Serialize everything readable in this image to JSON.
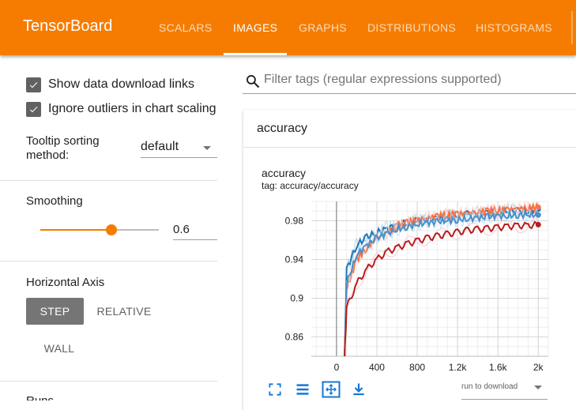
{
  "app": {
    "title": "TensorBoard",
    "accent_color": "#f57c00",
    "tabs": [
      {
        "label": "SCALARS",
        "active": false
      },
      {
        "label": "IMAGES",
        "active": true
      },
      {
        "label": "GRAPHS",
        "active": false
      },
      {
        "label": "DISTRIBUTIONS",
        "active": false
      },
      {
        "label": "HISTOGRAMS",
        "active": false
      }
    ]
  },
  "sidebar": {
    "checkboxes": [
      {
        "label": "Show data download links",
        "checked": true
      },
      {
        "label": "Ignore outliers in chart scaling",
        "checked": true
      }
    ],
    "tooltip_sorting": {
      "label": "Tooltip sorting method:",
      "value": "default"
    },
    "smoothing": {
      "label": "Smoothing",
      "value": "0.6",
      "fraction": 0.6
    },
    "horizontal_axis": {
      "label": "Horizontal Axis",
      "options": [
        "STEP",
        "RELATIVE",
        "WALL"
      ],
      "selected": "STEP"
    },
    "runs_label": "Runs"
  },
  "main": {
    "search_placeholder": "Filter tags (regular expressions supported)",
    "card_title": "accuracy",
    "chart": {
      "title": "accuracy",
      "tag": "tag: accuracy/accuracy"
    },
    "icons": [
      "fullscreen-icon",
      "list-icon",
      "fit-domain-icon",
      "download-icon"
    ],
    "run_download": "run to download"
  },
  "chart_data": {
    "type": "line",
    "title": "accuracy",
    "xlabel": "",
    "ylabel": "",
    "xlim": [
      -250,
      2100
    ],
    "ylim": [
      0.84,
      1.0
    ],
    "x_ticks": [
      0,
      400,
      800,
      1200,
      1600,
      2000
    ],
    "x_tick_labels": [
      "0",
      "400",
      "800",
      "1.2k",
      "1.6k",
      "2k"
    ],
    "y_ticks": [
      0.86,
      0.9,
      0.94,
      0.98
    ],
    "y_tick_labels": [
      "0.86",
      "0.9",
      "0.94",
      "0.98"
    ],
    "grid": true,
    "series": [
      {
        "color": "#1f77b4",
        "raw_color": "#a6cee3",
        "x": [
          100,
          200,
          300,
          400,
          500,
          600,
          700,
          800,
          900,
          1000,
          1100,
          1200,
          1300,
          1400,
          1500,
          1600,
          1700,
          1800,
          1900,
          2000
        ],
        "values": [
          0.93,
          0.955,
          0.963,
          0.968,
          0.972,
          0.976,
          0.978,
          0.98,
          0.982,
          0.983,
          0.984,
          0.986,
          0.987,
          0.988,
          0.988,
          0.989,
          0.99,
          0.99,
          0.991,
          0.992
        ]
      },
      {
        "color": "#ff7043",
        "raw_color": "#ffccbc",
        "x": [
          100,
          200,
          300,
          400,
          500,
          600,
          700,
          800,
          900,
          1000,
          1100,
          1200,
          1300,
          1400,
          1500,
          1600,
          1700,
          1800,
          1900,
          2000
        ],
        "values": [
          0.91,
          0.94,
          0.952,
          0.962,
          0.968,
          0.974,
          0.978,
          0.981,
          0.983,
          0.985,
          0.986,
          0.987,
          0.988,
          0.989,
          0.99,
          0.991,
          0.992,
          0.993,
          0.993,
          0.994
        ]
      },
      {
        "color": "#4a90c8",
        "raw_color": "#bbdefb",
        "x": [
          100,
          200,
          300,
          400,
          500,
          600,
          700,
          800,
          900,
          1000,
          1100,
          1200,
          1300,
          1400,
          1500,
          1600,
          1700,
          1800,
          1900,
          2000
        ],
        "values": [
          0.915,
          0.945,
          0.955,
          0.962,
          0.967,
          0.971,
          0.974,
          0.976,
          0.978,
          0.979,
          0.98,
          0.981,
          0.982,
          0.983,
          0.984,
          0.985,
          0.985,
          0.986,
          0.986,
          0.986
        ]
      },
      {
        "color": "#b71c1c",
        "raw_color": "#f8bbd0",
        "x": [
          100,
          200,
          300,
          400,
          500,
          600,
          700,
          800,
          900,
          1000,
          1100,
          1200,
          1300,
          1400,
          1500,
          1600,
          1700,
          1800,
          1900,
          2000
        ],
        "values": [
          0.89,
          0.915,
          0.93,
          0.94,
          0.948,
          0.952,
          0.956,
          0.959,
          0.962,
          0.964,
          0.966,
          0.968,
          0.97,
          0.971,
          0.972,
          0.973,
          0.974,
          0.975,
          0.975,
          0.976
        ]
      }
    ]
  }
}
